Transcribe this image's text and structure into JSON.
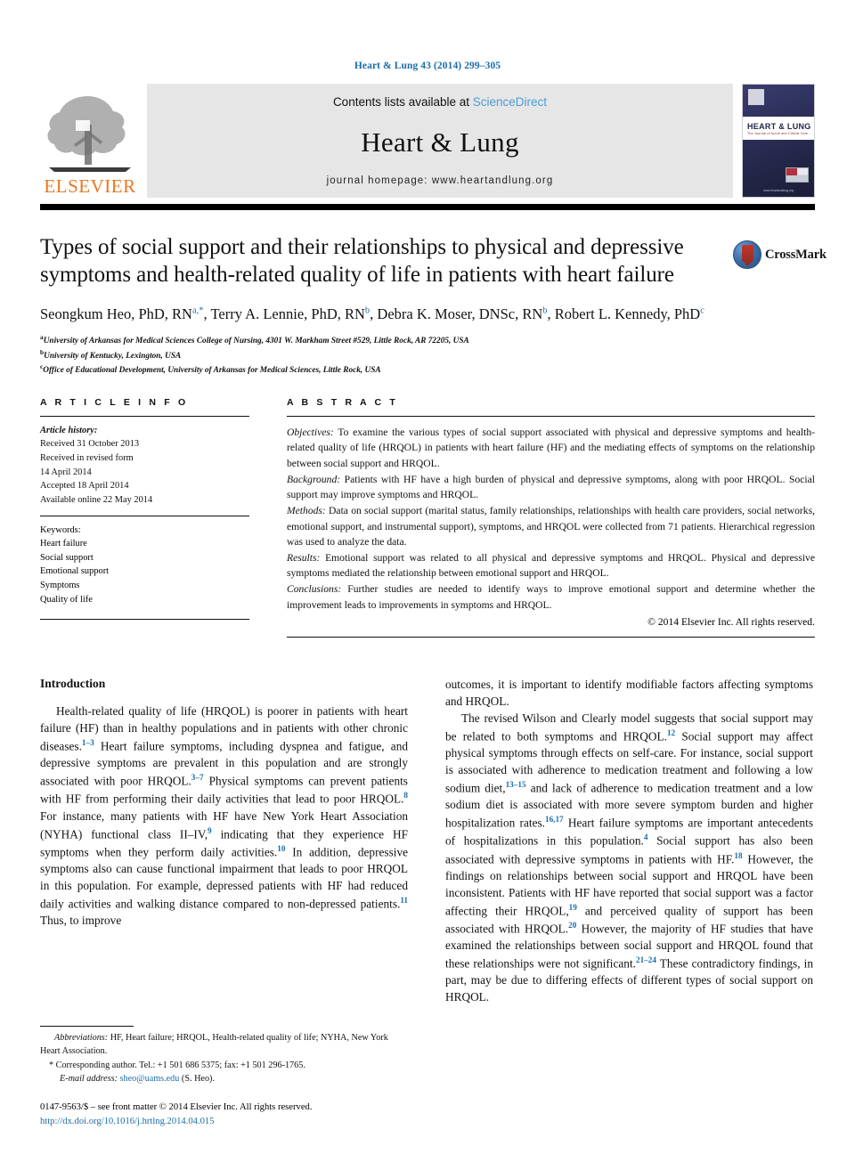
{
  "running_head": "Heart & Lung 43 (2014) 299–305",
  "masthead": {
    "elsevier_wordmark": "ELSEVIER",
    "contents_prefix": "Contents lists available at ",
    "contents_link": "ScienceDirect",
    "journal_title": "Heart & Lung",
    "homepage": "journal homepage: www.heartandlung.org",
    "cover": {
      "title": "HEART & LUNG",
      "subtitle": "The Journal of Acute and Critical Care",
      "url": "www.heartandlung.org"
    }
  },
  "article": {
    "title": "Types of social support and their relationships to physical and depressive symptoms and health-related quality of life in patients with heart failure",
    "authors": [
      {
        "name": "Seongkum Heo, PhD, RN",
        "marks": "a,*",
        "sep": ", "
      },
      {
        "name": "Terry A. Lennie, PhD, RN",
        "marks": "b",
        "sep": ", "
      },
      {
        "name": "Debra K. Moser, DNSc, RN",
        "marks": "b",
        "sep": ", "
      },
      {
        "name": "Robert L. Kennedy, PhD",
        "marks": "c",
        "sep": ""
      }
    ],
    "affiliations": [
      {
        "mark": "a",
        "text": "University of Arkansas for Medical Sciences College of Nursing, 4301 W. Markham Street #529, Little Rock, AR 72205, USA"
      },
      {
        "mark": "b",
        "text": "University of Kentucky, Lexington, USA"
      },
      {
        "mark": "c",
        "text": "Office of Educational Development, University of Arkansas for Medical Sciences, Little Rock, USA"
      }
    ],
    "crossmark_label": "CrossMark"
  },
  "article_info": {
    "heading": "A R T I C L E  I N F O",
    "history_label": "Article history:",
    "history": [
      "Received 31 October 2013",
      "Received in revised form",
      "14 April 2014",
      "Accepted 18 April 2014",
      "Available online 22 May 2014"
    ],
    "keywords_label": "Keywords:",
    "keywords": [
      "Heart failure",
      "Social support",
      "Emotional support",
      "Symptoms",
      "Quality of life"
    ]
  },
  "abstract": {
    "heading": "A B S T R A C T",
    "sections": [
      {
        "label": "Objectives:",
        "text": " To examine the various types of social support associated with physical and depressive symptoms and health-related quality of life (HRQOL) in patients with heart failure (HF) and the mediating effects of symptoms on the relationship between social support and HRQOL."
      },
      {
        "label": "Background:",
        "text": " Patients with HF have a high burden of physical and depressive symptoms, along with poor HRQOL. Social support may improve symptoms and HRQOL."
      },
      {
        "label": "Methods:",
        "text": " Data on social support (marital status, family relationships, relationships with health care providers, social networks, emotional support, and instrumental support), symptoms, and HRQOL were collected from 71 patients. Hierarchical regression was used to analyze the data."
      },
      {
        "label": "Results:",
        "text": " Emotional support was related to all physical and depressive symptoms and HRQOL. Physical and depressive symptoms mediated the relationship between emotional support and HRQOL."
      },
      {
        "label": "Conclusions:",
        "text": " Further studies are needed to identify ways to improve emotional support and determine whether the improvement leads to improvements in symptoms and HRQOL."
      }
    ],
    "copyright": "© 2014 Elsevier Inc. All rights reserved."
  },
  "body": {
    "intro_heading": "Introduction",
    "left_paragraphs": [
      "Health-related quality of life (HRQOL) is poorer in patients with heart failure (HF) than in healthy populations and in patients with other chronic diseases.[1–3] Heart failure symptoms, including dyspnea and fatigue, and depressive symptoms are prevalent in this population and are strongly associated with poor HRQOL.[3–7] Physical symptoms can prevent patients with HF from performing their daily activities that lead to poor HRQOL.[8] For instance, many patients with HF have New York Heart Association (NYHA) functional class II–IV,[9] indicating that they experience HF symptoms when they perform daily activities.[10] In addition, depressive symptoms also can cause functional impairment that leads to poor HRQOL in this population. For example, depressed patients with HF had reduced daily activities and walking distance compared to non-depressed patients.[11] Thus, to improve"
    ],
    "right_paragraphs": [
      "outcomes, it is important to identify modifiable factors affecting symptoms and HRQOL.",
      "The revised Wilson and Clearly model suggests that social support may be related to both symptoms and HRQOL.[12] Social support may affect physical symptoms through effects on self-care. For instance, social support is associated with adherence to medication treatment and following a low sodium diet,[13–15] and lack of adherence to medication treatment and a low sodium diet is associated with more severe symptom burden and higher hospitalization rates.[16,17] Heart failure symptoms are important antecedents of hospitalizations in this population.[4] Social support has also been associated with depressive symptoms in patients with HF.[18] However, the findings on relationships between social support and HRQOL have been inconsistent. Patients with HF have reported that social support was a factor affecting their HRQOL,[19] and perceived quality of support has been associated with HRQOL.[20] However, the majority of HF studies that have examined the relationships between social support and HRQOL found that these relationships were not significant.[21–24] These contradictory findings, in part, may be due to differing effects of different types of social support on HRQOL."
    ]
  },
  "footnotes": {
    "abbreviations_label": "Abbreviations:",
    "abbreviations_text": " HF, Heart failure; HRQOL, Health-related quality of life; NYHA, New York Heart Association.",
    "corresponding": "* Corresponding author. Tel.: +1 501 686 5375; fax: +1 501 296-1765.",
    "email_label": "E-mail address:",
    "email": "sheo@uams.edu",
    "email_suffix": " (S. Heo).",
    "imprint": "0147-9563/$ – see front matter © 2014 Elsevier Inc. All rights reserved.",
    "doi": "http://dx.doi.org/10.1016/j.hrtlng.2014.04.015"
  },
  "colors": {
    "link_blue": "#1b6ca8",
    "sciencedirect_blue": "#4a9ed4",
    "elsevier_orange": "#E87722",
    "masthead_gray": "#e6e6e6"
  }
}
